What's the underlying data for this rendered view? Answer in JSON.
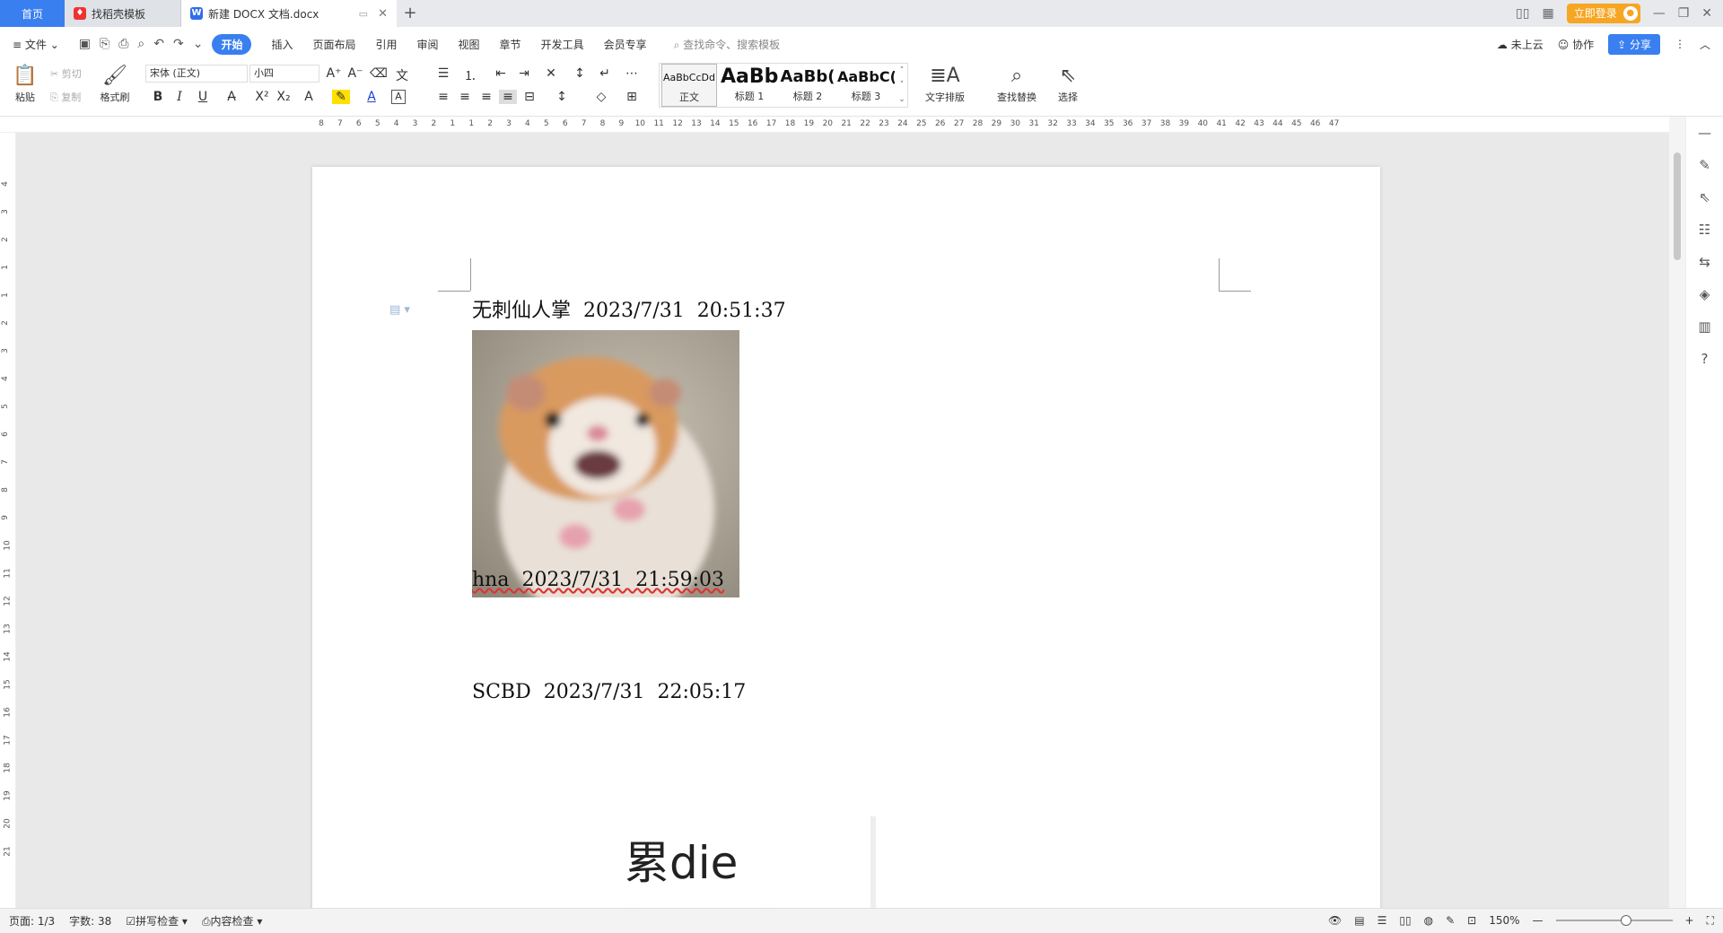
{
  "tabs": {
    "home": "首页",
    "template": "找稻壳模板",
    "document": "新建 DOCX 文档.docx",
    "add": "+"
  },
  "window": {
    "login": "立即登录"
  },
  "menu": {
    "file": "文件",
    "items": [
      "开始",
      "插入",
      "页面布局",
      "引用",
      "审阅",
      "视图",
      "章节",
      "开发工具",
      "会员专享"
    ],
    "search_placeholder": "查找命令、搜索模板",
    "cloud": "未上云",
    "collab": "协作",
    "share": "分享"
  },
  "ribbon": {
    "paste": "粘贴",
    "cut": "剪切",
    "copy": "复制",
    "format_painter": "格式刷",
    "font_name": "宋体 (正文)",
    "font_size": "小四",
    "styles": [
      {
        "preview": "AaBbCcDd",
        "label": "正文"
      },
      {
        "preview": "AaBb",
        "label": "标题 1"
      },
      {
        "preview": "AaBb(",
        "label": "标题 2"
      },
      {
        "preview": "AaBbC(",
        "label": "标题 3"
      }
    ],
    "text_layout": "文字排版",
    "find_replace": "查找替换",
    "select": "选择"
  },
  "ruler_numbers": [
    "8",
    "7",
    "6",
    "5",
    "4",
    "3",
    "2",
    "1",
    "1",
    "2",
    "3",
    "4",
    "5",
    "6",
    "7",
    "8",
    "9",
    "10",
    "11",
    "12",
    "13",
    "14",
    "15",
    "16",
    "17",
    "18",
    "19",
    "20",
    "21",
    "22",
    "23",
    "24",
    "25",
    "26",
    "27",
    "28",
    "29",
    "30",
    "31",
    "32",
    "33",
    "34",
    "35",
    "36",
    "37",
    "38",
    "39",
    "40",
    "41",
    "42",
    "43",
    "44",
    "45",
    "46",
    "47"
  ],
  "vruler_numbers": [
    "4",
    "3",
    "2",
    "1",
    "1",
    "2",
    "3",
    "4",
    "5",
    "6",
    "7",
    "8",
    "9",
    "10",
    "11",
    "12",
    "13",
    "14",
    "15",
    "16",
    "17",
    "18",
    "19",
    "20",
    "21"
  ],
  "document": {
    "entries": [
      {
        "text": "无刺仙人掌  2023/7/31  20:51:37"
      },
      {
        "text": "hna  2023/7/31  21:59:03"
      },
      {
        "text": "SCBD  2023/7/31  22:05:17"
      }
    ],
    "image2_caption": "累die"
  },
  "status": {
    "page": "页面: 1/3",
    "words": "字数: 38",
    "spellcheck": "拼写检查",
    "content_check": "内容检查",
    "zoom": "150%"
  },
  "colors": {
    "accent": "#3a7ff0",
    "login": "#f6a623"
  }
}
